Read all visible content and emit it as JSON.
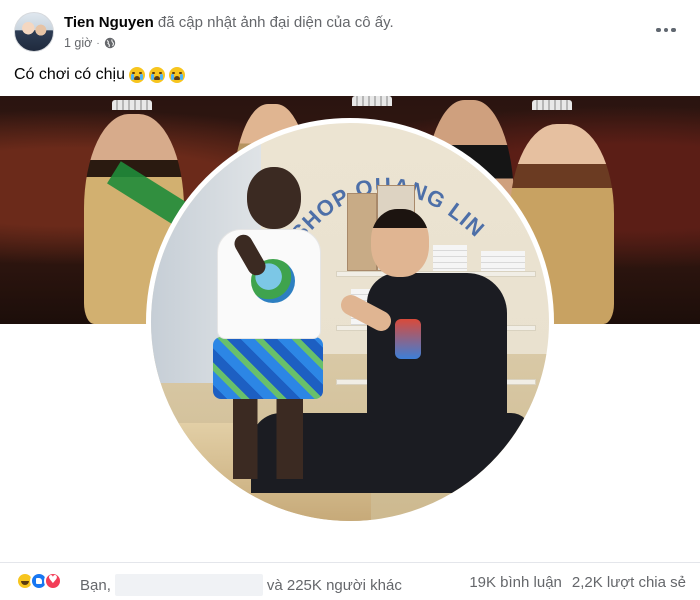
{
  "post": {
    "author": "Tien Nguyen",
    "action": "đã cập nhật ảnh đại diện của cô ấy.",
    "time": "1 giờ",
    "separator": "·",
    "privacy_icon": "globe-icon",
    "more_icon": "more-horizontal-icon",
    "caption": "Có chơi có chịu",
    "caption_emojis": [
      "crying-face-icon",
      "crying-face-icon",
      "crying-face-icon"
    ],
    "profile_photo_text": "SHOP QUANG LINH VLOG"
  },
  "reactions": {
    "icons": [
      "haha-icon",
      "like-icon",
      "love-icon"
    ],
    "prefix": "Bạn,",
    "suffix": "và 225K người khác",
    "comments": "19K bình luận",
    "shares": "2,2K lượt chia sẻ"
  },
  "colors": {
    "name": "#050505",
    "secondary": "#65676b",
    "like_blue": "#1877f2",
    "love_red": "#f33e58",
    "haha_yellow": "#f7c51e"
  }
}
